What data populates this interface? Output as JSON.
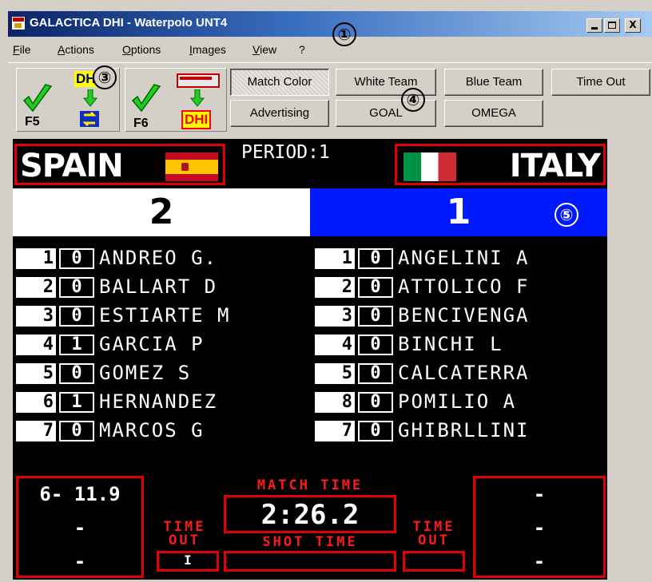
{
  "window": {
    "title": "GALACTICA DHI - Waterpolo UNT4",
    "close_glyph": "X"
  },
  "menu": [
    "File",
    "Actions",
    "Options",
    "Images",
    "View",
    "?"
  ],
  "toolbar": {
    "group1": {
      "badge": "DHI",
      "fkey": "F5"
    },
    "group2": {
      "badge": "DHI",
      "fkey": "F6"
    },
    "buttons": {
      "match_color": "Match Color",
      "white_team": "White Team",
      "blue_team": "Blue Team",
      "time_out": "Time Out",
      "advertising": "Advertising",
      "goal": "GOAL",
      "omega": "OMEGA"
    }
  },
  "annotations": [
    "①",
    "③",
    "④",
    "⑤"
  ],
  "scoreboard": {
    "home": {
      "name": "SPAIN",
      "score": "2"
    },
    "away": {
      "name": "ITALY",
      "score": "1"
    },
    "period_label": "PERIOD:1",
    "home_players": [
      {
        "num": "1",
        "goals": "0",
        "name": "ANDREO G."
      },
      {
        "num": "2",
        "goals": "0",
        "name": "BALLART D"
      },
      {
        "num": "3",
        "goals": "0",
        "name": "ESTIARTE M"
      },
      {
        "num": "4",
        "goals": "1",
        "name": "GARCIA P"
      },
      {
        "num": "5",
        "goals": "0",
        "name": "GOMEZ S"
      },
      {
        "num": "6",
        "goals": "1",
        "name": "HERNANDEZ"
      },
      {
        "num": "7",
        "goals": "0",
        "name": "MARCOS G"
      }
    ],
    "away_players": [
      {
        "num": "1",
        "goals": "0",
        "name": "ANGELINI A"
      },
      {
        "num": "2",
        "goals": "0",
        "name": "ATTOLICO F"
      },
      {
        "num": "3",
        "goals": "0",
        "name": "BENCIVENGA"
      },
      {
        "num": "4",
        "goals": "0",
        "name": "BINCHI L"
      },
      {
        "num": "5",
        "goals": "0",
        "name": "CALCATERRA"
      },
      {
        "num": "8",
        "goals": "0",
        "name": "POMILIO A"
      },
      {
        "num": "7",
        "goals": "0",
        "name": "GHIBRLLINI"
      }
    ],
    "home_penalties": [
      "6- 11.9",
      "-",
      "-"
    ],
    "away_penalties": [
      "-",
      "-",
      "-"
    ],
    "match_time_label": "MATCH TIME",
    "match_time": "2:26.2",
    "shot_time_label": "SHOT TIME",
    "shot_time": "",
    "time_out_label_top": "TIME",
    "time_out_label_bottom": "OUT",
    "home_timeout": "I",
    "away_timeout": ""
  }
}
